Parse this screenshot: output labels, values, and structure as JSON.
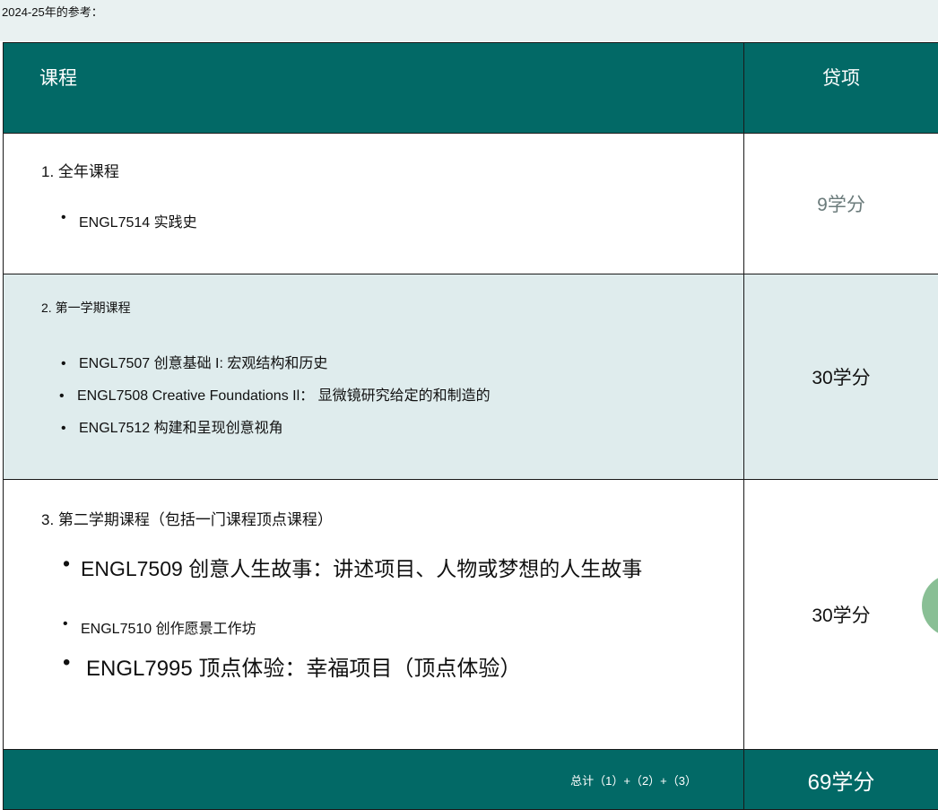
{
  "header_note": "2024-25年的参考：",
  "table": {
    "col_course": "课程",
    "col_credits": "贷项",
    "sections": [
      {
        "title": "1. 全年课程",
        "items": [
          "ENGL7514 实践史"
        ],
        "credits": "9学分"
      },
      {
        "title": "2. 第一学期课程",
        "items": [
          "ENGL7507 创意基础 I: 宏观结构和历史",
          "ENGL7508 Creative Foundations Il： 显微镜研究给定的和制造的",
          "ENGL7512 构建和呈现创意视角"
        ],
        "credits": "30学分"
      },
      {
        "title": "3. 第二学期课程（包括一门课程顶点课程）",
        "items": [
          "ENGL7509 创意人生故事：讲述项目、人物或梦想的人生故事",
          "ENGL7510 创作愿景工作坊",
          "ENGL7995 顶点体验：幸福项目（顶点体验）"
        ],
        "credits": "30学分"
      }
    ],
    "total_label": "总计（1）+（2）+（3）",
    "total_credits": "69学分"
  },
  "colors": {
    "header_bg": "#026966",
    "band_bg": "#dfeced",
    "top_bg": "#e9f1f1"
  }
}
